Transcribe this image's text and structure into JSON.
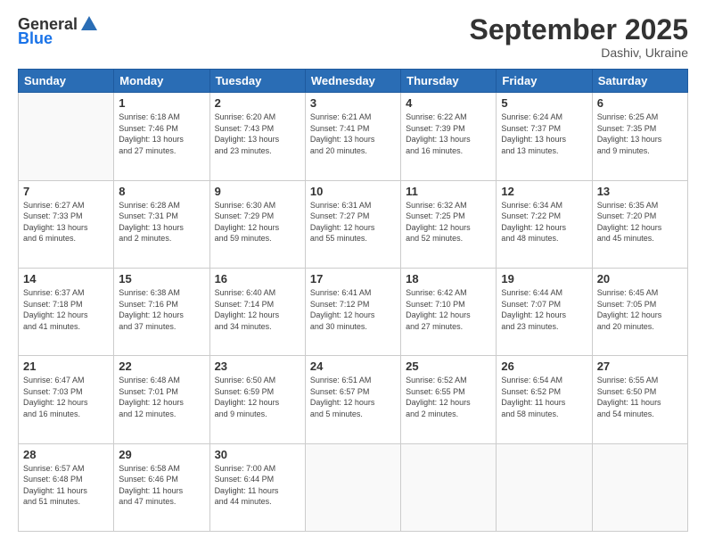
{
  "logo": {
    "general": "General",
    "blue": "Blue"
  },
  "header": {
    "month": "September 2025",
    "location": "Dashiv, Ukraine"
  },
  "weekdays": [
    "Sunday",
    "Monday",
    "Tuesday",
    "Wednesday",
    "Thursday",
    "Friday",
    "Saturday"
  ],
  "weeks": [
    [
      {
        "day": "",
        "info": ""
      },
      {
        "day": "1",
        "info": "Sunrise: 6:18 AM\nSunset: 7:46 PM\nDaylight: 13 hours\nand 27 minutes."
      },
      {
        "day": "2",
        "info": "Sunrise: 6:20 AM\nSunset: 7:43 PM\nDaylight: 13 hours\nand 23 minutes."
      },
      {
        "day": "3",
        "info": "Sunrise: 6:21 AM\nSunset: 7:41 PM\nDaylight: 13 hours\nand 20 minutes."
      },
      {
        "day": "4",
        "info": "Sunrise: 6:22 AM\nSunset: 7:39 PM\nDaylight: 13 hours\nand 16 minutes."
      },
      {
        "day": "5",
        "info": "Sunrise: 6:24 AM\nSunset: 7:37 PM\nDaylight: 13 hours\nand 13 minutes."
      },
      {
        "day": "6",
        "info": "Sunrise: 6:25 AM\nSunset: 7:35 PM\nDaylight: 13 hours\nand 9 minutes."
      }
    ],
    [
      {
        "day": "7",
        "info": "Sunrise: 6:27 AM\nSunset: 7:33 PM\nDaylight: 13 hours\nand 6 minutes."
      },
      {
        "day": "8",
        "info": "Sunrise: 6:28 AM\nSunset: 7:31 PM\nDaylight: 13 hours\nand 2 minutes."
      },
      {
        "day": "9",
        "info": "Sunrise: 6:30 AM\nSunset: 7:29 PM\nDaylight: 12 hours\nand 59 minutes."
      },
      {
        "day": "10",
        "info": "Sunrise: 6:31 AM\nSunset: 7:27 PM\nDaylight: 12 hours\nand 55 minutes."
      },
      {
        "day": "11",
        "info": "Sunrise: 6:32 AM\nSunset: 7:25 PM\nDaylight: 12 hours\nand 52 minutes."
      },
      {
        "day": "12",
        "info": "Sunrise: 6:34 AM\nSunset: 7:22 PM\nDaylight: 12 hours\nand 48 minutes."
      },
      {
        "day": "13",
        "info": "Sunrise: 6:35 AM\nSunset: 7:20 PM\nDaylight: 12 hours\nand 45 minutes."
      }
    ],
    [
      {
        "day": "14",
        "info": "Sunrise: 6:37 AM\nSunset: 7:18 PM\nDaylight: 12 hours\nand 41 minutes."
      },
      {
        "day": "15",
        "info": "Sunrise: 6:38 AM\nSunset: 7:16 PM\nDaylight: 12 hours\nand 37 minutes."
      },
      {
        "day": "16",
        "info": "Sunrise: 6:40 AM\nSunset: 7:14 PM\nDaylight: 12 hours\nand 34 minutes."
      },
      {
        "day": "17",
        "info": "Sunrise: 6:41 AM\nSunset: 7:12 PM\nDaylight: 12 hours\nand 30 minutes."
      },
      {
        "day": "18",
        "info": "Sunrise: 6:42 AM\nSunset: 7:10 PM\nDaylight: 12 hours\nand 27 minutes."
      },
      {
        "day": "19",
        "info": "Sunrise: 6:44 AM\nSunset: 7:07 PM\nDaylight: 12 hours\nand 23 minutes."
      },
      {
        "day": "20",
        "info": "Sunrise: 6:45 AM\nSunset: 7:05 PM\nDaylight: 12 hours\nand 20 minutes."
      }
    ],
    [
      {
        "day": "21",
        "info": "Sunrise: 6:47 AM\nSunset: 7:03 PM\nDaylight: 12 hours\nand 16 minutes."
      },
      {
        "day": "22",
        "info": "Sunrise: 6:48 AM\nSunset: 7:01 PM\nDaylight: 12 hours\nand 12 minutes."
      },
      {
        "day": "23",
        "info": "Sunrise: 6:50 AM\nSunset: 6:59 PM\nDaylight: 12 hours\nand 9 minutes."
      },
      {
        "day": "24",
        "info": "Sunrise: 6:51 AM\nSunset: 6:57 PM\nDaylight: 12 hours\nand 5 minutes."
      },
      {
        "day": "25",
        "info": "Sunrise: 6:52 AM\nSunset: 6:55 PM\nDaylight: 12 hours\nand 2 minutes."
      },
      {
        "day": "26",
        "info": "Sunrise: 6:54 AM\nSunset: 6:52 PM\nDaylight: 11 hours\nand 58 minutes."
      },
      {
        "day": "27",
        "info": "Sunrise: 6:55 AM\nSunset: 6:50 PM\nDaylight: 11 hours\nand 54 minutes."
      }
    ],
    [
      {
        "day": "28",
        "info": "Sunrise: 6:57 AM\nSunset: 6:48 PM\nDaylight: 11 hours\nand 51 minutes."
      },
      {
        "day": "29",
        "info": "Sunrise: 6:58 AM\nSunset: 6:46 PM\nDaylight: 11 hours\nand 47 minutes."
      },
      {
        "day": "30",
        "info": "Sunrise: 7:00 AM\nSunset: 6:44 PM\nDaylight: 11 hours\nand 44 minutes."
      },
      {
        "day": "",
        "info": ""
      },
      {
        "day": "",
        "info": ""
      },
      {
        "day": "",
        "info": ""
      },
      {
        "day": "",
        "info": ""
      }
    ]
  ]
}
